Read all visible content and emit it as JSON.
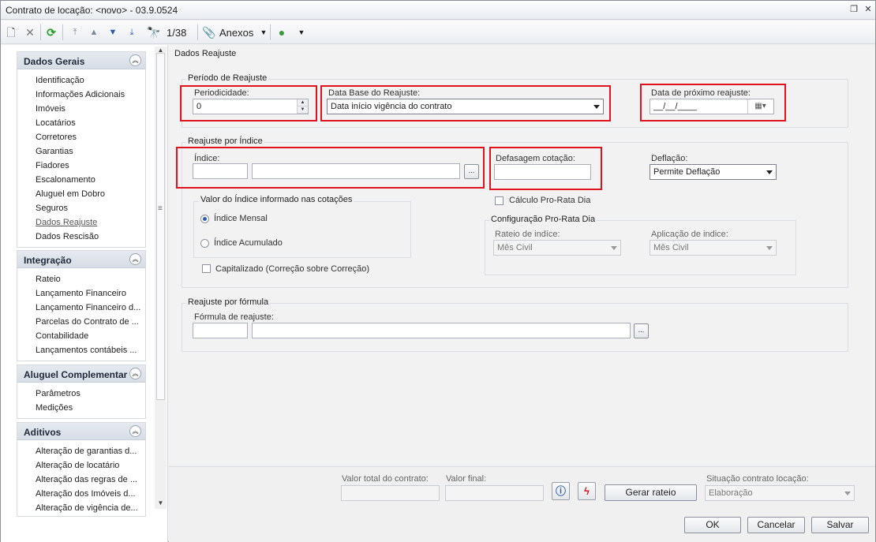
{
  "window": {
    "title": "Contrato de locação: <novo> - 03.9.0524"
  },
  "toolbar": {
    "record_counter": "1/38",
    "anexos_label": "Anexos"
  },
  "sidebar": {
    "groups": [
      {
        "title": "Dados Gerais",
        "items": [
          "Identificação",
          "Informações Adicionais",
          "Imóveis",
          "Locatários",
          "Corretores",
          "Garantias",
          "Fiadores",
          "Escalonamento",
          "Aluguel em Dobro",
          "Seguros",
          "Dados Reajuste",
          "Dados Rescisão"
        ]
      },
      {
        "title": "Integração",
        "items": [
          "Rateio",
          "Lançamento Financeiro",
          "Lançamento Financeiro d...",
          "Parcelas do Contrato de ...",
          "Contabilidade",
          "Lançamentos contábeis ..."
        ]
      },
      {
        "title": "Aluguel Complementar",
        "items": [
          "Parâmetros",
          "Medições"
        ]
      },
      {
        "title": "Aditivos",
        "items": [
          "Alteração de garantias d...",
          "Alteração de locatário",
          "Alteração das regras de ...",
          "Alteração dos Imóveis d...",
          "Alteração de vigência de..."
        ]
      }
    ]
  },
  "main": {
    "page_title": "Dados Reajuste",
    "periodo": {
      "title": "Período de Reajuste",
      "periodicidade_label": "Periodicidade:",
      "periodicidade_value": "0",
      "data_base_label": "Data Base do Reajuste:",
      "data_base_value": "Data início vigência do contrato",
      "proximo_label": "Data de próximo reajuste:",
      "proximo_value": "__/__/____"
    },
    "indice": {
      "title": "Reajuste por Índice",
      "indice_label": "Índice:",
      "defasagem_label": "Defasagem cotação:",
      "deflacao_label": "Deflação:",
      "deflacao_value": "Permite Deflação",
      "valor_group_title": "Valor do Índice informado nas cotações",
      "radio_mensal": "Índice Mensal",
      "radio_acumulado": "Índice Acumulado",
      "calculo_prorata": "Cálculo Pro-Rata Dia",
      "capitalizado": "Capitalizado (Correção sobre Correção)",
      "config_title": "Configuração Pro-Rata Dia",
      "rateio_label": "Rateio de indíce:",
      "rateio_value": "Mês Civil",
      "aplicacao_label": "Aplicação de indice:",
      "aplicacao_value": "Mês Civil"
    },
    "formula": {
      "title": "Reajuste por fórmula",
      "formula_label": "Fórmula de reajuste:"
    }
  },
  "footer": {
    "valor_total_label": "Valor total do contrato:",
    "valor_final_label": "Valor final:",
    "gerar_rateio": "Gerar rateio",
    "situacao_label": "Situação contrato locação:",
    "situacao_value": "Elaboração",
    "ok": "OK",
    "cancelar": "Cancelar",
    "salvar": "Salvar"
  }
}
